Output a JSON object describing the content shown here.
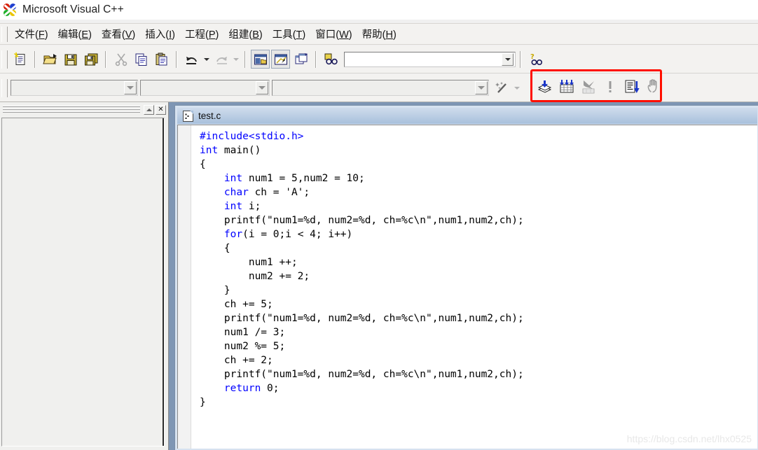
{
  "window": {
    "title": "Microsoft Visual C++",
    "logo_icon": "vcpp-logo-icon"
  },
  "menubar": {
    "items": [
      {
        "name": "menu-file",
        "text": "文件",
        "accel": "F"
      },
      {
        "name": "menu-edit",
        "text": "编辑",
        "accel": "E"
      },
      {
        "name": "menu-view",
        "text": "查看",
        "accel": "V"
      },
      {
        "name": "menu-insert",
        "text": "插入",
        "accel": "I"
      },
      {
        "name": "menu-project",
        "text": "工程",
        "accel": "P"
      },
      {
        "name": "menu-build",
        "text": "组建",
        "accel": "B"
      },
      {
        "name": "menu-tools",
        "text": "工具",
        "accel": "T"
      },
      {
        "name": "menu-window",
        "text": "窗口",
        "accel": "W"
      },
      {
        "name": "menu-help",
        "text": "帮助",
        "accel": "H"
      }
    ]
  },
  "standard_toolbar": {
    "buttons": [
      {
        "name": "new-text-file-button",
        "icon": "new-document-icon",
        "enabled": true
      },
      {
        "name": "open-button",
        "icon": "open-folder-icon",
        "enabled": true
      },
      {
        "name": "save-button",
        "icon": "floppy-disk-icon",
        "enabled": true
      },
      {
        "name": "save-all-button",
        "icon": "save-all-icon",
        "enabled": true
      },
      {
        "name": "cut-button",
        "icon": "scissors-icon",
        "enabled": false
      },
      {
        "name": "copy-button",
        "icon": "copy-icon",
        "enabled": true
      },
      {
        "name": "paste-button",
        "icon": "clipboard-paste-icon",
        "enabled": true
      },
      {
        "name": "undo-button",
        "icon": "undo-arrow-icon",
        "enabled": true
      },
      {
        "name": "redo-button",
        "icon": "redo-arrow-icon",
        "enabled": false
      },
      {
        "name": "workspace-button",
        "icon": "workspace-window-icon",
        "enabled": true
      },
      {
        "name": "output-button",
        "icon": "output-window-icon",
        "enabled": true
      },
      {
        "name": "window-list-button",
        "icon": "window-list-icon",
        "enabled": true
      },
      {
        "name": "find-in-files-button",
        "icon": "find-in-files-icon",
        "enabled": true
      }
    ],
    "find_combo": {
      "value": "",
      "placeholder": ""
    },
    "help_button": {
      "name": "search-help-button",
      "icon": "help-find-icon"
    }
  },
  "wizardbar": {
    "class_combo": {
      "value": "",
      "placeholder": ""
    },
    "filter_combo": {
      "value": "",
      "placeholder": ""
    },
    "member_combo": {
      "value": "",
      "placeholder": ""
    },
    "actions_button": {
      "name": "wizardbar-actions-button",
      "icon": "magic-wand-icon"
    }
  },
  "build_minibar": {
    "highlight_color": "#ff0f00",
    "buttons": [
      {
        "name": "compile-button",
        "icon": "compile-icon",
        "label": "Compile",
        "enabled": true
      },
      {
        "name": "build-button",
        "icon": "build-icon",
        "label": "Build",
        "enabled": true
      },
      {
        "name": "stop-build-button",
        "icon": "stop-build-icon",
        "label": "Stop Build",
        "enabled": false
      },
      {
        "name": "execute-button",
        "icon": "exclamation-icon",
        "label": "Execute Program",
        "enabled": false
      },
      {
        "name": "go-button",
        "icon": "go-debug-icon",
        "label": "Go",
        "enabled": true
      },
      {
        "name": "insert-breakpoint-button",
        "icon": "hand-breakpoint-icon",
        "label": "Insert/Remove Breakpoint",
        "enabled": false
      }
    ]
  },
  "workspace_pane": {
    "title": "",
    "close_label": "✕",
    "content": ""
  },
  "editor": {
    "tab_title": "test.c",
    "file_icon": "source-file-icon",
    "code_lines": [
      {
        "indent": 0,
        "parts": [
          {
            "t": "#include<stdio.h>",
            "k": true
          }
        ]
      },
      {
        "indent": 0,
        "parts": [
          {
            "t": "int",
            "k": true
          },
          {
            "t": " main()",
            "k": false
          }
        ]
      },
      {
        "indent": 0,
        "parts": [
          {
            "t": "{",
            "k": false
          }
        ]
      },
      {
        "indent": 1,
        "parts": [
          {
            "t": "int",
            "k": true
          },
          {
            "t": " num1 = 5,num2 = 10;",
            "k": false
          }
        ]
      },
      {
        "indent": 1,
        "parts": [
          {
            "t": "char",
            "k": true
          },
          {
            "t": " ch = 'A';",
            "k": false
          }
        ]
      },
      {
        "indent": 1,
        "parts": [
          {
            "t": "int",
            "k": true
          },
          {
            "t": " i;",
            "k": false
          }
        ]
      },
      {
        "indent": 1,
        "parts": [
          {
            "t": "printf(\"num1=%d, num2=%d, ch=%c\\n\",num1,num2,ch);",
            "k": false
          }
        ]
      },
      {
        "indent": 1,
        "parts": [
          {
            "t": "for",
            "k": true
          },
          {
            "t": "(i = 0;i < 4; i++)",
            "k": false
          }
        ]
      },
      {
        "indent": 1,
        "parts": [
          {
            "t": "{",
            "k": false
          }
        ]
      },
      {
        "indent": 2,
        "parts": [
          {
            "t": "num1 ++;",
            "k": false
          }
        ]
      },
      {
        "indent": 2,
        "parts": [
          {
            "t": "num2 += 2;",
            "k": false
          }
        ]
      },
      {
        "indent": 1,
        "parts": [
          {
            "t": "}",
            "k": false
          }
        ]
      },
      {
        "indent": 1,
        "parts": [
          {
            "t": "ch += 5;",
            "k": false
          }
        ]
      },
      {
        "indent": 1,
        "parts": [
          {
            "t": "printf(\"num1=%d, num2=%d, ch=%c\\n\",num1,num2,ch);",
            "k": false
          }
        ]
      },
      {
        "indent": 1,
        "parts": [
          {
            "t": "num1 /= 3;",
            "k": false
          }
        ]
      },
      {
        "indent": 1,
        "parts": [
          {
            "t": "num2 %= 5;",
            "k": false
          }
        ]
      },
      {
        "indent": 1,
        "parts": [
          {
            "t": "ch += 2;",
            "k": false
          }
        ]
      },
      {
        "indent": 1,
        "parts": [
          {
            "t": "printf(\"num1=%d, num2=%d, ch=%c\\n\",num1,num2,ch);",
            "k": false
          }
        ]
      },
      {
        "indent": 1,
        "parts": [
          {
            "t": "return",
            "k": true
          },
          {
            "t": " 0;",
            "k": false
          }
        ]
      },
      {
        "indent": 0,
        "parts": [
          {
            "t": "}",
            "k": false
          }
        ]
      }
    ]
  },
  "watermark": {
    "text": "https://blog.csdn.net/lhx0525"
  }
}
